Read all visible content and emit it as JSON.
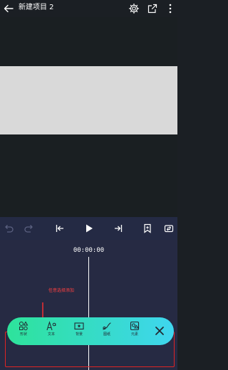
{
  "header": {
    "title": "新建项目 2",
    "icons": [
      "back-arrow-icon",
      "gear-icon",
      "export-icon",
      "more-vertical-icon"
    ]
  },
  "controls": {
    "icons": [
      "undo-icon",
      "redo-icon",
      "skip-to-start-icon",
      "play-icon",
      "skip-to-end-icon",
      "bookmark-icon",
      "replace-icon"
    ]
  },
  "timeline": {
    "timecode": "00:00:00",
    "annotation": "任意选择添加"
  },
  "toolbar": {
    "tools": [
      {
        "label": "形状",
        "icon": "shapes-icon"
      },
      {
        "label": "文本",
        "icon": "text-icon"
      },
      {
        "label": "背景",
        "icon": "background-icon"
      },
      {
        "label": "图纸",
        "icon": "pen-icon"
      },
      {
        "label": "元素",
        "icon": "elements-icon"
      }
    ],
    "close_icon": "close-icon"
  },
  "colors": {
    "accent_gradient_start": "#2ee39b",
    "accent_gradient_end": "#3fd6ef",
    "annotation": "#ff4040",
    "timeline_bg": "#262a43",
    "preview_bg": "#1a1f22"
  }
}
